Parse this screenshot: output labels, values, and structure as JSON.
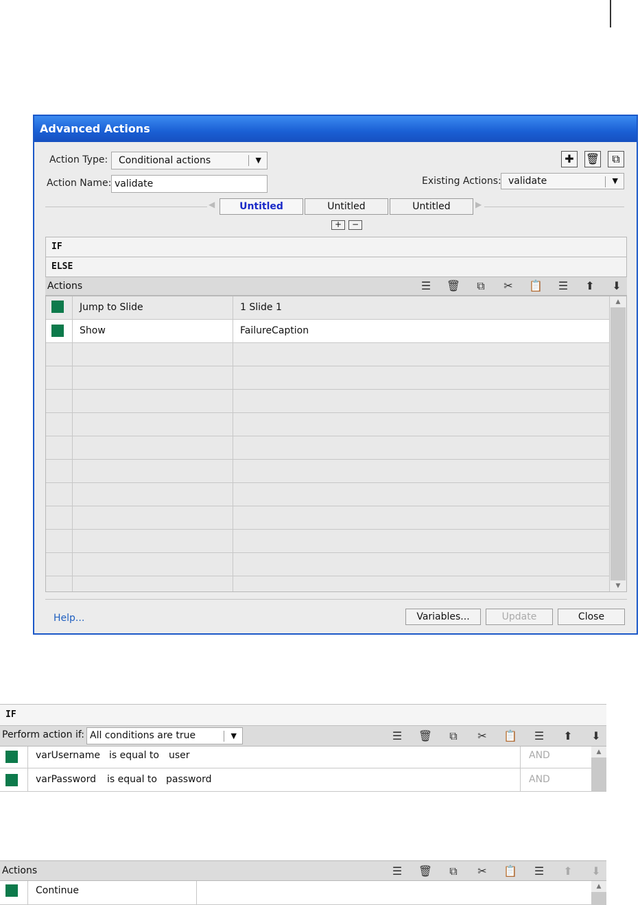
{
  "dialog": {
    "title": "Advanced Actions",
    "action_type_label": "Action Type:",
    "action_type_value": "Conditional actions",
    "action_name_label": "Action Name:",
    "action_name_value": "validate",
    "existing_label": "Existing Actions:",
    "existing_value": "validate",
    "tabs": [
      "Untitled",
      "Untitled",
      "Untitled"
    ],
    "if_label": "IF",
    "else_label": "ELSE",
    "actions_label": "Actions",
    "rows": [
      {
        "action": "Jump to Slide",
        "target": "1 Slide 1"
      },
      {
        "action": "Show",
        "target": "FailureCaption"
      }
    ],
    "help_label": "Help...",
    "variables_label": "Variables...",
    "update_label": "Update",
    "close_label": "Close"
  },
  "if_panel": {
    "if_label": "IF",
    "perform_label": "Perform action if:",
    "perform_value": "All conditions are true",
    "conditions": [
      {
        "var": "varUsername",
        "op": "is equal to",
        "value": "user",
        "join": "AND"
      },
      {
        "var": "varPassword",
        "op": "is equal to",
        "value": "password",
        "join": "AND"
      }
    ]
  },
  "actions_panel": {
    "label": "Actions",
    "row": "Continue"
  },
  "colors": {
    "titlebar": "#1a5fd4",
    "status_square": "#0d7a4b"
  }
}
